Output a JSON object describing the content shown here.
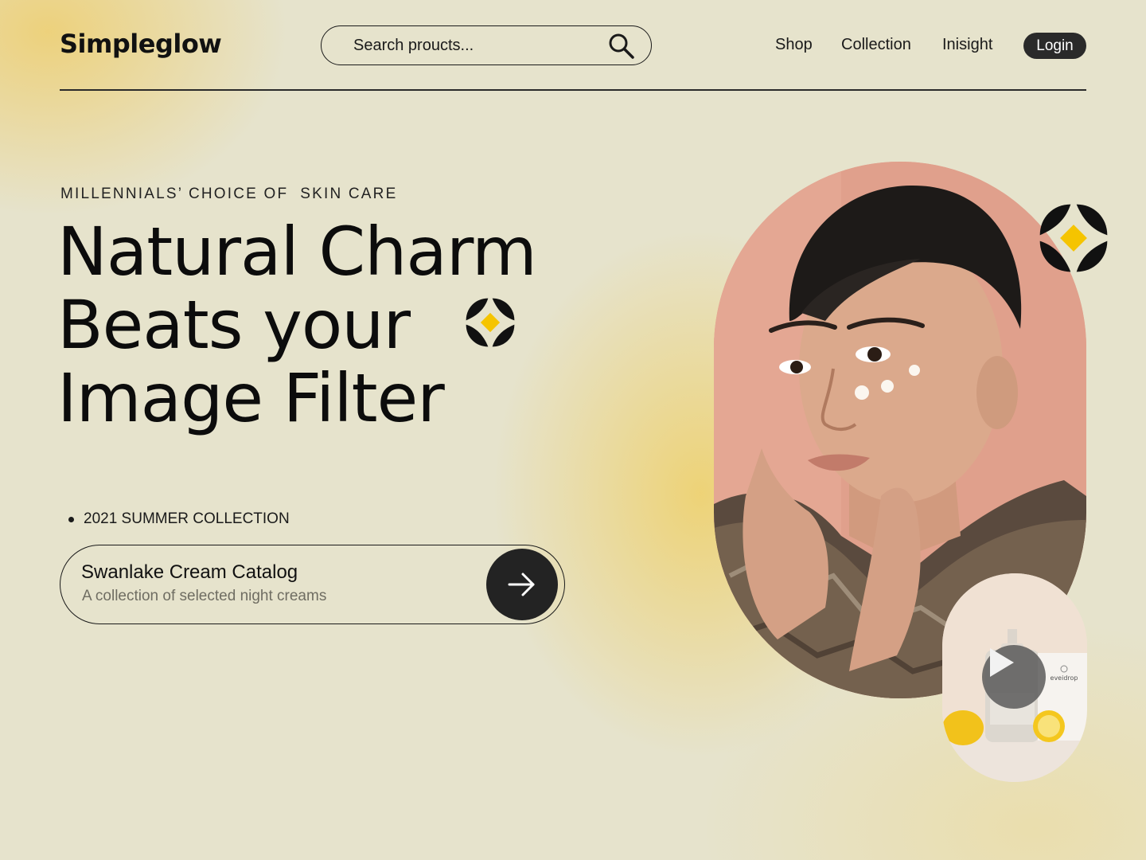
{
  "brand": {
    "name": "Simpleglow"
  },
  "search": {
    "placeholder": "Search proucts..."
  },
  "nav": {
    "items": [
      {
        "label": "Shop"
      },
      {
        "label": "Collection"
      },
      {
        "label": "Inisight"
      }
    ],
    "login_label": "Login"
  },
  "hero": {
    "eyebrow": "MILLENNIALS’ CHOICE OF  SKIN CARE",
    "headline": [
      "Natural Charm",
      "Beats your",
      "Image Filter"
    ],
    "collection_tag": "2021 SUMMER COLLECTION",
    "catalog": {
      "title": "Swanlake Cream Catalog",
      "subtitle": "A collection of selected night creams"
    }
  },
  "video": {
    "product_brand": "eveidrop"
  },
  "colors": {
    "background": "#e6e3cc",
    "accent_yellow": "#f5c400",
    "dark": "#232323",
    "portrait_backdrop": "#e09c88"
  },
  "icons": {
    "search": "search-icon",
    "arrow": "arrow-right-icon",
    "play": "play-icon",
    "sparkle": "sparkle-icon"
  }
}
